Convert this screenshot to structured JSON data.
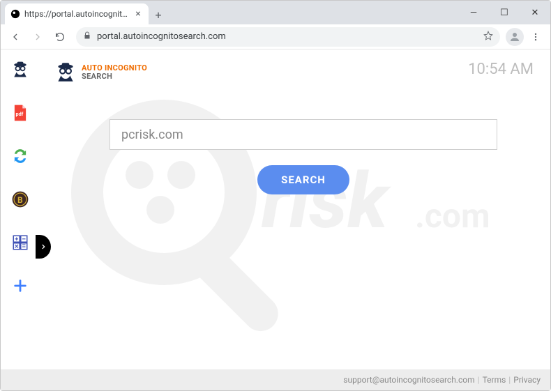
{
  "window": {
    "tab_title": "https://portal.autoincognitosearch",
    "controls": {
      "min": "—",
      "max": "☐",
      "close": "✕"
    }
  },
  "toolbar": {
    "url_display": "portal.autoincognitosearch.com"
  },
  "brand": {
    "line1": "AUTO INCOGNITO",
    "line2": "SEARCH"
  },
  "clock": "10:54 AM",
  "search": {
    "value": "pcrisk.com",
    "button": "SEARCH"
  },
  "sidebar": {
    "items": [
      {
        "name": "spy-icon"
      },
      {
        "name": "pdf-icon"
      },
      {
        "name": "sync-icon"
      },
      {
        "name": "coin-b-icon"
      },
      {
        "name": "calculator-icon"
      },
      {
        "name": "add-icon"
      }
    ]
  },
  "footer": {
    "email": "support@autoincognitosearch.com",
    "terms": "Terms",
    "privacy": "Privacy"
  },
  "watermark": "pcrisk.com"
}
